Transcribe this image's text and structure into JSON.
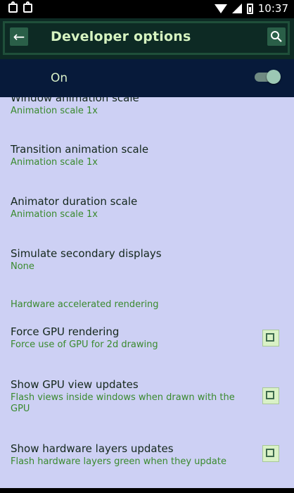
{
  "status_bar": {
    "time": "10:37"
  },
  "app_bar": {
    "title": "Developer options"
  },
  "master_switch": {
    "label": "On",
    "state": "on"
  },
  "list": {
    "items_top": [
      {
        "title": "Window animation scale",
        "summary": "Animation scale 1x"
      },
      {
        "title": "Transition animation scale",
        "summary": "Animation scale 1x"
      },
      {
        "title": "Animator duration scale",
        "summary": "Animation scale 1x"
      },
      {
        "title": "Simulate secondary displays",
        "summary": "None"
      }
    ],
    "section_header": "Hardware accelerated rendering",
    "items_check": [
      {
        "title": "Force GPU rendering",
        "summary": "Force use of GPU for 2d drawing",
        "checked": false
      },
      {
        "title": "Show GPU view updates",
        "summary": "Flash views inside windows when drawn with the GPU",
        "checked": false
      },
      {
        "title": "Show hardware layers updates",
        "summary": "Flash hardware layers green when they update",
        "checked": false
      }
    ]
  },
  "colors": {
    "list_bg": "#cdd0f4",
    "accent": "#3a8a2e",
    "app_bar": "#0d2a24",
    "master_bar": "#071a3a"
  }
}
